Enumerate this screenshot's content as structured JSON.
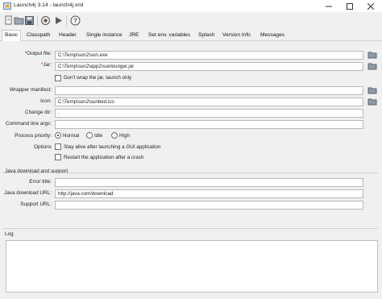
{
  "window": {
    "title": "Launch4j 3.14 - launch4j.xml",
    "controls": [
      "minimize",
      "maximize",
      "close"
    ]
  },
  "toolbar": {
    "buttons": [
      "new-icon",
      "open-icon",
      "save-icon",
      "build-icon",
      "run-icon",
      "help-icon"
    ]
  },
  "tabs": [
    "Basic",
    "Classpath",
    "Header",
    "Single instance",
    "JRE",
    "Set env. variables",
    "Splash",
    "Version Info",
    "Messages"
  ],
  "active_tab": "Basic",
  "basic": {
    "output_file": {
      "required_mark": "*",
      "label": "Output file:",
      "value": "C:\\Temp\\sun2\\sun.exe"
    },
    "jar": {
      "required_mark": "*",
      "label": "Jar:",
      "value": "C:\\Temp\\sun2\\app2\\sunlounger.jar"
    },
    "dont_wrap": {
      "label": "Don't wrap the jar, launch only",
      "checked": false
    },
    "wrapper_manifest": {
      "label": "Wrapper manifest:",
      "value": ""
    },
    "icon": {
      "label": "Icon:",
      "value": "C:\\Temp\\sun2\\sunbed.ico"
    },
    "change_dir": {
      "label": "Change dir:",
      "value": "."
    },
    "cmd_args": {
      "label": "Command line args:",
      "value": ""
    },
    "process_priority": {
      "label": "Process priority:",
      "options": [
        "Normal",
        "Idle",
        "High"
      ],
      "selected": "Normal"
    },
    "options": {
      "label": "Options",
      "stay_alive": {
        "label": "Stay alive after launching a GUI application",
        "checked": false
      },
      "restart": {
        "label": "Restart the application after a crash",
        "checked": false
      }
    }
  },
  "java_download": {
    "section_title": "Java download and support",
    "error_title": {
      "label": "Error title:",
      "value": ""
    },
    "download_url": {
      "label": "Java download URL:",
      "value": "http://java.com/download"
    },
    "support_url": {
      "label": "Support URL:",
      "value": ""
    }
  },
  "log": {
    "title": "Log",
    "content": ""
  }
}
